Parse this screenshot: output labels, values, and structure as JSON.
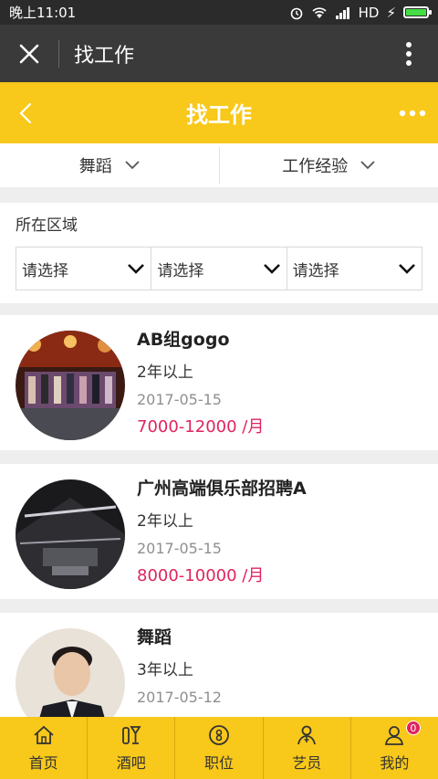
{
  "status_bar": {
    "time": "晚上11:01",
    "network": "HD"
  },
  "wechat_bar": {
    "title": "找工作"
  },
  "header": {
    "title": "找工作"
  },
  "filters": [
    {
      "label": "舞蹈"
    },
    {
      "label": "工作经验"
    }
  ],
  "region": {
    "label": "所在区域",
    "selects": [
      "请选择",
      "请选择",
      "请选择"
    ]
  },
  "jobs": [
    {
      "name": "AB组gogo",
      "experience": "2年以上",
      "date": "2017-05-15",
      "salary": "7000-12000 /月"
    },
    {
      "name": "广州高端俱乐部招聘A",
      "experience": "2年以上",
      "date": "2017-05-15",
      "salary": "8000-10000 /月"
    },
    {
      "name": "舞蹈",
      "experience": "3年以上",
      "date": "2017-05-12",
      "salary": ""
    }
  ],
  "tabs": [
    {
      "label": "首页",
      "icon": "home-icon"
    },
    {
      "label": "酒吧",
      "icon": "bar-icon"
    },
    {
      "label": "职位",
      "icon": "job-icon"
    },
    {
      "label": "艺员",
      "icon": "artist-icon"
    },
    {
      "label": "我的",
      "icon": "profile-icon",
      "badge": "0"
    }
  ],
  "colors": {
    "accent": "#f8c81a",
    "salary": "#e0245e",
    "dark_bar": "#3a3a3a"
  }
}
